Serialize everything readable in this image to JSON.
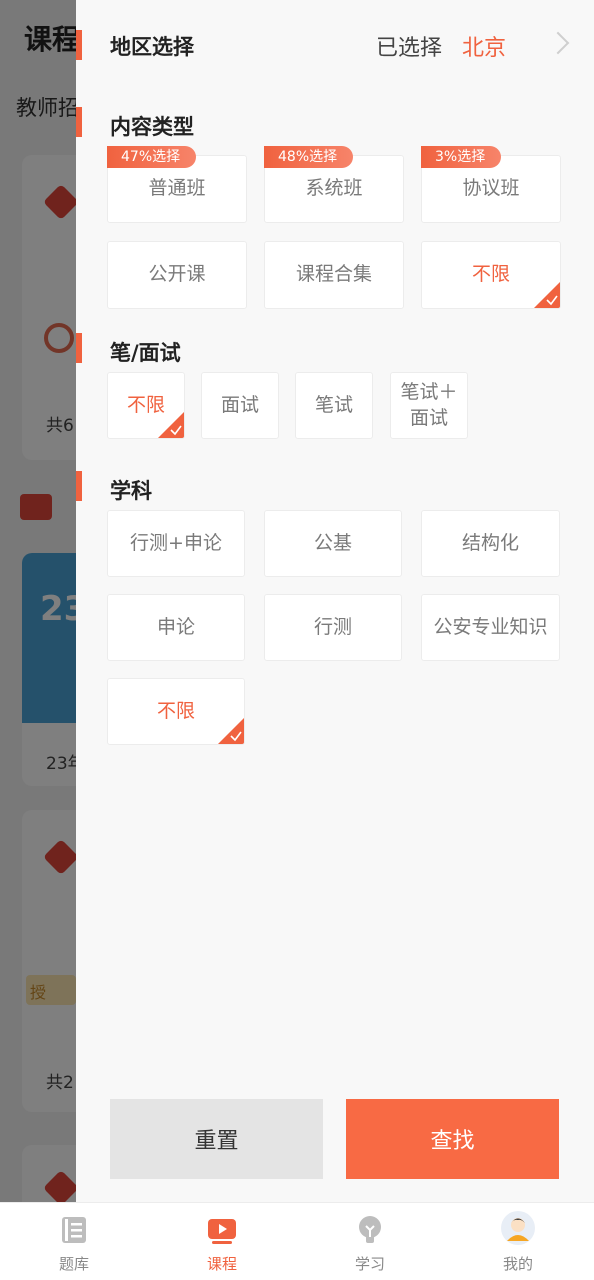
{
  "background": {
    "page_title": "课程",
    "tab_label": "教师招",
    "card1_count_text": "共6",
    "card2_label": "23年",
    "card2_banner_number": "23",
    "card3_tag": "授",
    "card3_count_text": "共2"
  },
  "filter": {
    "region": {
      "title": "地区选择",
      "selected_label": "已选择",
      "selected_value": "北京"
    },
    "content_type": {
      "title": "内容类型",
      "options": [
        {
          "label": "普通班",
          "badge": "47%选择",
          "selected": false
        },
        {
          "label": "系统班",
          "badge": "48%选择",
          "selected": false
        },
        {
          "label": "协议班",
          "badge": "3%选择",
          "selected": false
        },
        {
          "label": "公开课",
          "selected": false
        },
        {
          "label": "课程合集",
          "selected": false
        },
        {
          "label": "不限",
          "selected": true
        }
      ]
    },
    "exam_type": {
      "title": "笔/面试",
      "options": [
        {
          "label": "不限",
          "selected": true
        },
        {
          "label": "面试",
          "selected": false
        },
        {
          "label": "笔试",
          "selected": false
        },
        {
          "label": "笔试＋面试",
          "selected": false
        }
      ]
    },
    "subject": {
      "title": "学科",
      "options": [
        {
          "label": "行测+申论",
          "selected": false
        },
        {
          "label": "公基",
          "selected": false
        },
        {
          "label": "结构化",
          "selected": false
        },
        {
          "label": "申论",
          "selected": false
        },
        {
          "label": "行测",
          "selected": false
        },
        {
          "label": "公安专业知识",
          "selected": false
        },
        {
          "label": "不限",
          "selected": true
        }
      ]
    },
    "reset_label": "重置",
    "search_label": "查找"
  },
  "tabbar": {
    "items": [
      {
        "label": "题库",
        "icon": "question-bank-icon",
        "active": false
      },
      {
        "label": "课程",
        "icon": "course-play-icon",
        "active": true
      },
      {
        "label": "学习",
        "icon": "lightbulb-icon",
        "active": false
      },
      {
        "label": "我的",
        "icon": "avatar-icon",
        "active": false
      }
    ]
  },
  "colors": {
    "accent": "#f0623f",
    "search_button": "#f86a44",
    "reset_button": "#e4e4e4"
  }
}
